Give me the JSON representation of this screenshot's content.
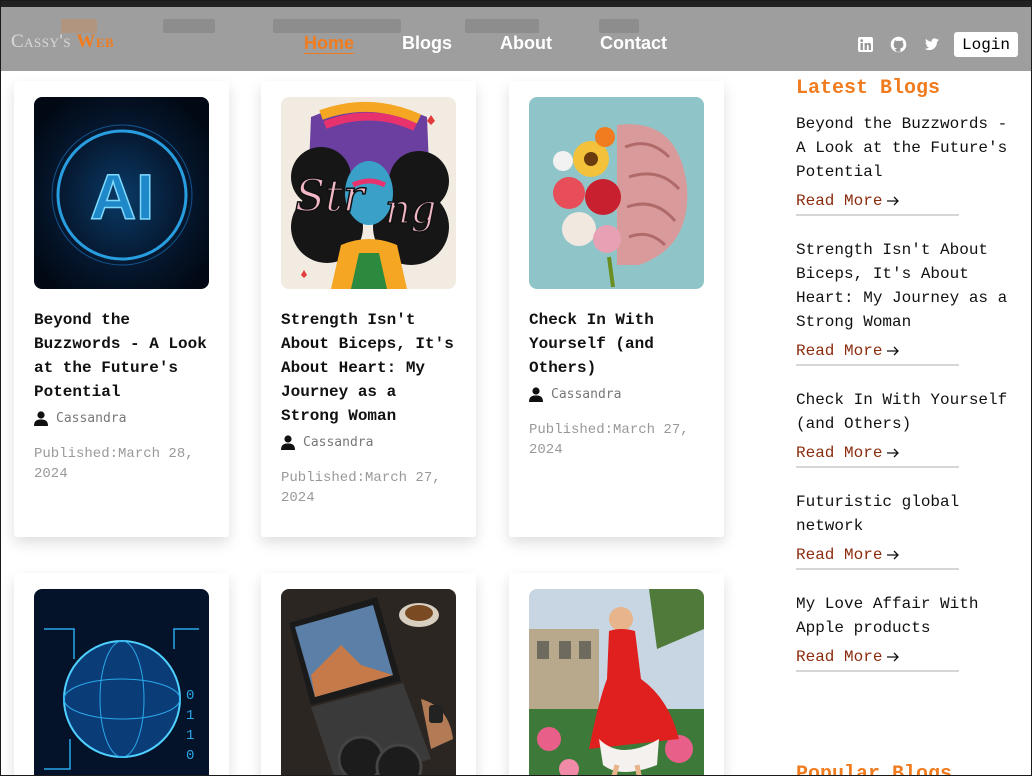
{
  "brand": {
    "part1": "Cassy's",
    "part2": "Web"
  },
  "nav": [
    {
      "label": "Home",
      "active": true
    },
    {
      "label": "Blogs",
      "active": false
    },
    {
      "label": "About",
      "active": false
    },
    {
      "label": "Contact",
      "active": false
    }
  ],
  "header": {
    "login_label": "Login"
  },
  "social": [
    "linkedin-icon",
    "github-icon",
    "twitter-icon"
  ],
  "colors": {
    "accent": "#f07c1f",
    "read_more": "#8b2c0e",
    "header_bg": "#969696"
  },
  "cards": [
    {
      "title": "Beyond the Buzzwords - A Look at the Future's Potential",
      "author": "Cassandra",
      "published": "Published:March 28, 2024",
      "image": "ai-glow-image"
    },
    {
      "title": "Strength Isn't About Biceps, It's About Heart: My Journey as a Strong Woman",
      "author": "Cassandra",
      "published": "Published:March 27, 2024",
      "image": "strong-woman-illustration"
    },
    {
      "title": "Check In With Yourself (and Others)",
      "author": "Cassandra",
      "published": "Published:March 27, 2024",
      "image": "flower-brain-illustration"
    },
    {
      "title": "",
      "author": "",
      "published": "",
      "image": "digital-globe-image"
    },
    {
      "title": "",
      "author": "",
      "published": "",
      "image": "laptop-coffee-image"
    },
    {
      "title": "",
      "author": "",
      "published": "",
      "image": "red-dress-garden-image"
    }
  ],
  "sidebar": {
    "latest_heading": "Latest Blogs",
    "popular_heading": "Popular Blogs",
    "read_more_label": "Read More",
    "latest": [
      {
        "title": "Beyond the Buzzwords - A Look at the Future's Potential"
      },
      {
        "title": "Strength Isn't About Biceps, It's About Heart: My Journey as a Strong Woman"
      },
      {
        "title": "Check In With Yourself (and Others)"
      },
      {
        "title": "Futuristic global network"
      },
      {
        "title": "My Love Affair With Apple products"
      }
    ]
  }
}
